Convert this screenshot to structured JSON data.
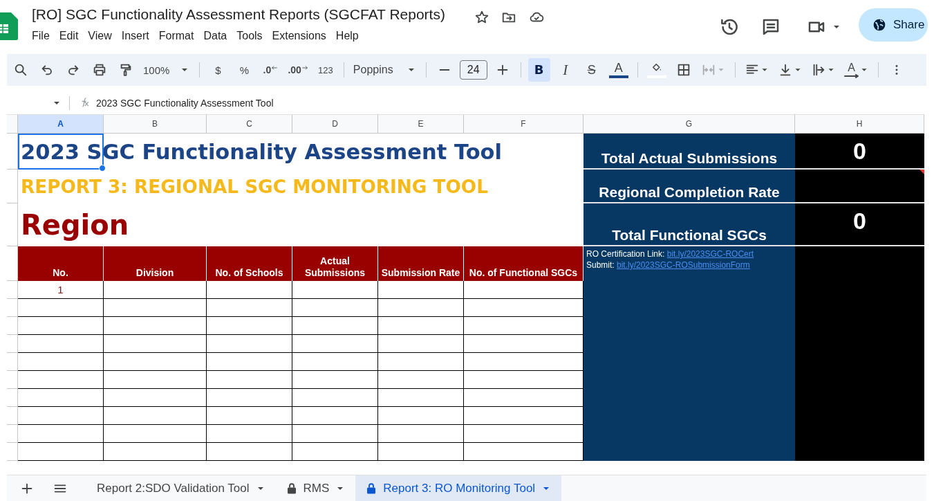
{
  "document": {
    "title": "[RO] SGC Functionality Assessment Reports (SGCFAT Reports)",
    "share_label": "Share"
  },
  "menu": [
    "File",
    "Edit",
    "View",
    "Insert",
    "Format",
    "Data",
    "Tools",
    "Extensions",
    "Help"
  ],
  "toolbar": {
    "zoom": "100%",
    "currency": "$",
    "percent": "%",
    "decrease_decimal": ".0",
    "increase_decimal": ".00",
    "number_format": "123",
    "font": "Poppins",
    "font_size": "24",
    "rotation_label": "A",
    "text_style": [
      {
        "kind": "bold",
        "label": "B",
        "selected": true
      },
      {
        "kind": "italic",
        "label": "I",
        "selected": false
      },
      {
        "kind": "strikethrough",
        "label": "S",
        "selected": false
      },
      {
        "kind": "text_color",
        "label": "A",
        "selected": false
      }
    ]
  },
  "formula_bar": {
    "content": "2023 SGC Functionality Assessment Tool"
  },
  "columns": [
    {
      "label": "A",
      "selected": true
    },
    {
      "label": "B",
      "selected": false
    },
    {
      "label": "C",
      "selected": false
    },
    {
      "label": "D",
      "selected": false
    },
    {
      "label": "E",
      "selected": false
    },
    {
      "label": "F",
      "selected": false
    },
    {
      "label": "G",
      "selected": false
    },
    {
      "label": "H",
      "selected": false
    }
  ],
  "sheet": {
    "title": "2023 SGC Functionality Assessment Tool",
    "subtitle": "REPORT 3: REGIONAL SGC MONITORING TOOL",
    "region_label": "Region",
    "table": {
      "columns": [
        "No.",
        "Division",
        "No. of Schools",
        "Actual Submissions",
        "Submission Rate",
        "No. of Functional SGCs"
      ],
      "rows": [
        {
          "no": "1"
        }
      ]
    },
    "summary": [
      {
        "label": "Total Actual Submissions",
        "value": "0"
      },
      {
        "label": "Regional Completion Rate",
        "has_comment": true
      },
      {
        "label": "Total Functional SGCs",
        "value": "0"
      }
    ],
    "links": [
      {
        "label": "RO Certification Link:",
        "link": "bit.ly/2023SGC-ROCert"
      },
      {
        "label": "Submit:",
        "link": "bit.ly/2023SGC-ROSubmissionForm"
      }
    ]
  },
  "sheet_tabs": [
    {
      "label": "Report 2:SDO Validation Tool",
      "locked": false,
      "selected": false
    },
    {
      "label": "RMS",
      "locked": true,
      "selected": false
    },
    {
      "label": "Report 3: RO Monitoring Tool",
      "locked": true,
      "selected": true
    }
  ]
}
